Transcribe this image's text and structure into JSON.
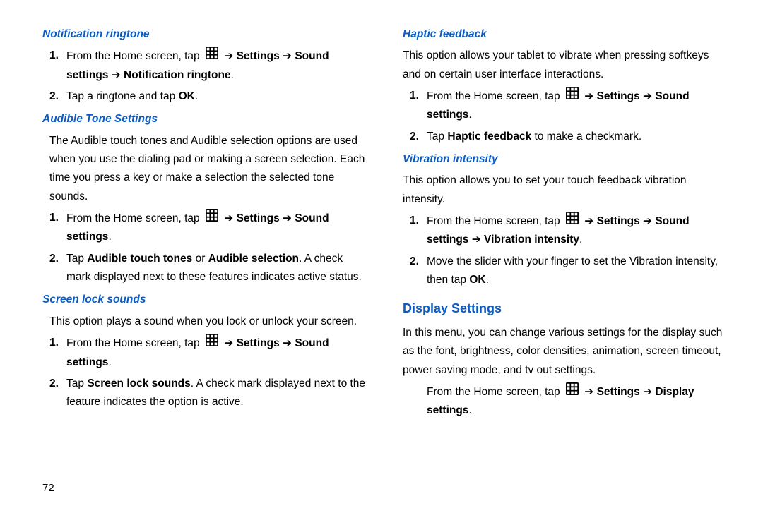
{
  "page_number": "72",
  "common": {
    "from_home_tap": "From the Home screen, tap ",
    "settings": "Settings",
    "sound": "Sound",
    "settings_lower": "settings",
    "arrow": " ➔ ",
    "ok": "OK",
    "display": "Display"
  },
  "left": {
    "s1_title": "Notification ringtone",
    "s1_path_cont": "Notification ringtone",
    "s1_step2_a": "Tap a ringtone and tap ",
    "s1_step2_b": ".",
    "s2_title": "Audible Tone Settings",
    "s2_intro": "The Audible touch tones and Audible selection options are used when you use the dialing pad or making a screen selection. Each time you press a key or make a selection the selected tone sounds.",
    "s2_step2_a": "Tap ",
    "s2_step2_b": "Audible touch tones",
    "s2_step2_c": " or ",
    "s2_step2_d": "Audible selection",
    "s2_step2_e": ". A check mark displayed next to these features indicates active status.",
    "s3_title": "Screen lock sounds",
    "s3_intro": "This option plays a sound when you lock or unlock your screen.",
    "s3_step2_a": "Tap ",
    "s3_step2_b": "Screen lock sounds",
    "s3_step2_c": ". A check mark displayed next to the feature indicates the option is active."
  },
  "right": {
    "s1_title": "Haptic feedback",
    "s1_intro": "This option allows your tablet to vibrate when pressing softkeys and on certain user interface interactions.",
    "s1_step2_a": "Tap ",
    "s1_step2_b": "Haptic feedback",
    "s1_step2_c": " to make a checkmark.",
    "s2_title": "Vibration intensity",
    "s2_intro": "This option allows you to set your touch feedback vibration intensity.",
    "s2_path_cont": "Vibration intensity",
    "s2_step2_a": "Move the slider with your finger to set the Vibration intensity, then tap ",
    "s2_step2_b": ".",
    "s3_title": "Display Settings",
    "s3_intro": "In this menu, you can change various settings for the display such as the font, brightness, color densities, animation, screen timeout, power saving mode, and tv out settings."
  }
}
